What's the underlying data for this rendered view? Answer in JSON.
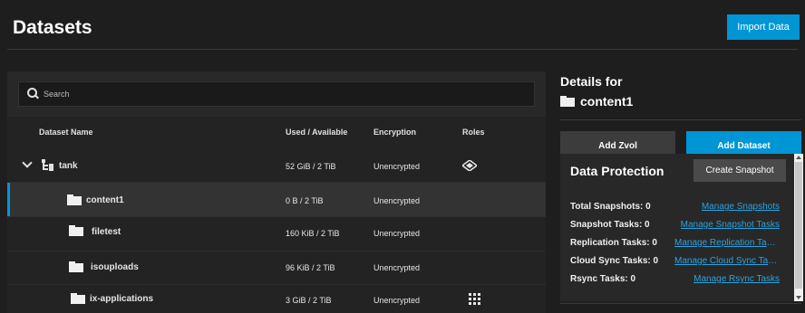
{
  "header": {
    "title": "Datasets",
    "import_label": "Import Data"
  },
  "search": {
    "placeholder": "Search"
  },
  "table": {
    "columns": [
      "Dataset Name",
      "Used / Available",
      "Encryption",
      "Roles"
    ],
    "rows": [
      {
        "name": "tank",
        "usage": "52 GiB / 2 TiB",
        "encryption": "Unencrypted",
        "role_icon": "sharing-icon",
        "expanded": true
      },
      {
        "name": "content1",
        "usage": "0 B / 2 TiB",
        "encryption": "Unencrypted",
        "role_icon": "",
        "selected": true
      },
      {
        "name": "filetest",
        "usage": "160 KiB / 2 TiB",
        "encryption": "Unencrypted",
        "role_icon": ""
      },
      {
        "name": "isouploads",
        "usage": "96 KiB / 2 TiB",
        "encryption": "Unencrypted",
        "role_icon": ""
      },
      {
        "name": "ix-applications",
        "usage": "3 GiB / 2 TiB",
        "encryption": "Unencrypted",
        "role_icon": "apps-icon"
      }
    ]
  },
  "details": {
    "title": "Details for",
    "dataset_name": "content1",
    "add_zvol_label": "Add Zvol",
    "add_dataset_label": "Add Dataset"
  },
  "data_protection": {
    "title": "Data Protection",
    "create_snapshot_label": "Create Snapshot",
    "rows": [
      {
        "label": "Total Snapshots: 0",
        "link": "Manage Snapshots"
      },
      {
        "label": "Snapshot Tasks: 0",
        "link": "Manage Snapshot Tasks"
      },
      {
        "label": "Replication Tasks: 0",
        "link": "Manage Replication Tasks"
      },
      {
        "label": "Cloud Sync Tasks: 0",
        "link": "Manage Cloud Sync Tasks"
      },
      {
        "label": "Rsync Tasks: 0",
        "link": "Manage Rsync Tasks"
      }
    ]
  },
  "colors": {
    "accent": "#0095d5",
    "link": "#2ba3e0",
    "background": "#1e1e1e"
  }
}
